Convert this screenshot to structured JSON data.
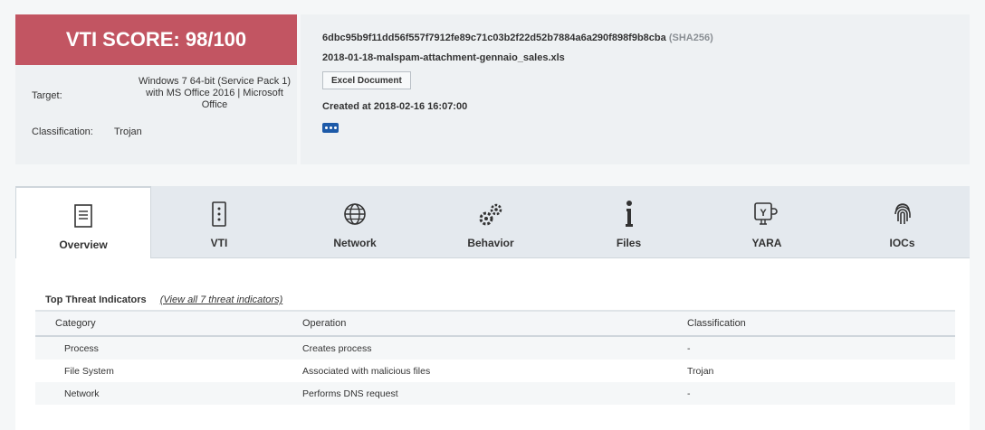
{
  "score": {
    "banner": "VTI SCORE: 98/100",
    "target_label": "Target:",
    "target_lines": [
      "Windows 7 64-bit (Service Pack 1)",
      "with MS Office 2016 | Microsoft",
      "Office"
    ],
    "classification_label": "Classification:",
    "classification_value": "Trojan"
  },
  "file": {
    "hash": "6dbc95b9f11dd56f557f7912fe89c71c03b2f22d52b7884a6a290f898f9b8cba",
    "hash_type": "(SHA256)",
    "filename": "2018-01-18-malspam-attachment-gennaio_sales.xls",
    "type_badge": "Excel Document",
    "created": "Created at 2018-02-16 16:07:00"
  },
  "tabs": [
    {
      "label": "Overview",
      "icon": "document-icon",
      "active": true
    },
    {
      "label": "VTI",
      "icon": "server-icon",
      "active": false
    },
    {
      "label": "Network",
      "icon": "globe-icon",
      "active": false
    },
    {
      "label": "Behavior",
      "icon": "gears-icon",
      "active": false
    },
    {
      "label": "Files",
      "icon": "info-icon",
      "active": false
    },
    {
      "label": "YARA",
      "icon": "yara-icon",
      "active": false
    },
    {
      "label": "IOCs",
      "icon": "fingerprint-icon",
      "active": false
    }
  ],
  "indicators": {
    "title": "Top Threat Indicators",
    "view_all": "(View all 7 threat indicators)",
    "columns": [
      "Category",
      "Operation",
      "Classification"
    ],
    "rows": [
      [
        "Process",
        "Creates process",
        "-"
      ],
      [
        "File System",
        "Associated with malicious files",
        "Trojan"
      ],
      [
        "Network",
        "Performs DNS request",
        "-"
      ]
    ]
  },
  "colors": {
    "score_banner": "#c25562",
    "accent_button": "#1d5aa8"
  }
}
